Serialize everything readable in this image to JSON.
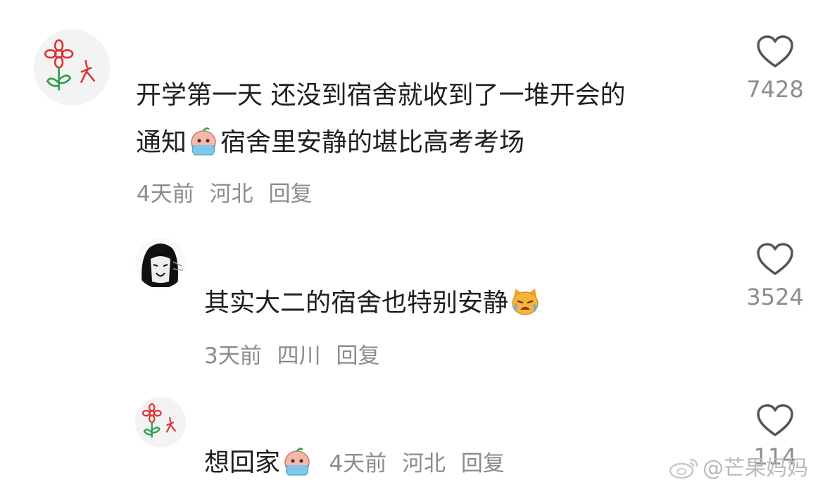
{
  "comments": [
    {
      "text_line1": "开学第一天  还没到宿舍就收到了一堆开会的",
      "text_line2_a": "通知",
      "text_line2_b": "宿舍里安静的堪比高考考场",
      "emoji": "crying-face-emoji",
      "time": "4天前",
      "location": "河北",
      "reply": "回复",
      "likes": "7428"
    },
    {
      "text_a": "其实大二的宿舍也特别安静",
      "emoji": "crying-cat-emoji",
      "time": "3天前",
      "location": "四川",
      "reply": "回复",
      "likes": "3524"
    },
    {
      "text_a": "想回家",
      "emoji": "crying-face-emoji",
      "time": "4天前",
      "location": "河北",
      "reply": "回复",
      "likes": "114"
    }
  ],
  "watermark": "@芒果妈妈",
  "colors": {
    "text": "#1f1f1f",
    "meta": "#8c8c8c",
    "avatar_bg": "#f2f2f2"
  }
}
